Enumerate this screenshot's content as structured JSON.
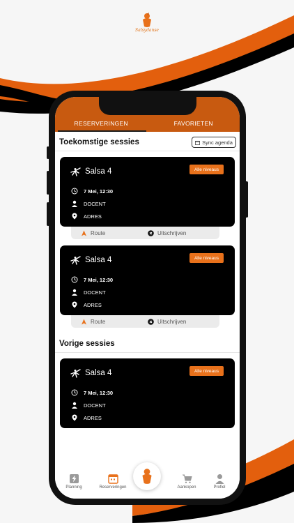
{
  "brand": {
    "logo_text": "Salsydanse",
    "accent_color": "#e8711b",
    "dark_orange": "#c85a10"
  },
  "tabs": [
    {
      "label": "RESERVERINGEN",
      "active": true
    },
    {
      "label": "FAVORIETEN",
      "active": false
    }
  ],
  "upcoming": {
    "title": "Toekomstige sessies",
    "sync_label": "Sync agenda",
    "sessions": [
      {
        "name": "Salsa 4",
        "level": "Alle niveaus",
        "datetime": "7 Mei, 12:30",
        "teacher": "DOCENT",
        "address": "ADRES",
        "route_label": "Route",
        "unsubscribe_label": "Uitschrijven"
      },
      {
        "name": "Salsa 4",
        "level": "Alle niveaus",
        "datetime": "7 Mei, 12:30",
        "teacher": "DOCENT",
        "address": "ADRES",
        "route_label": "Route",
        "unsubscribe_label": "Uitschrijven"
      }
    ]
  },
  "previous": {
    "title": "Vorige sessies",
    "sessions": [
      {
        "name": "Salsa 4",
        "level": "Alle niveaus",
        "datetime": "7 Mei, 12:30",
        "teacher": "DOCENT",
        "address": "ADRES"
      }
    ]
  },
  "bottom_nav": [
    {
      "label": "Planning",
      "icon": "lightning-icon",
      "active": false
    },
    {
      "label": "Reserveringen",
      "icon": "calendar-icon",
      "active": true
    },
    {
      "label": "",
      "icon": "logo-icon",
      "active": false
    },
    {
      "label": "Aankopen",
      "icon": "cart-icon",
      "active": false
    },
    {
      "label": "Profiel",
      "icon": "person-icon",
      "active": false
    }
  ]
}
